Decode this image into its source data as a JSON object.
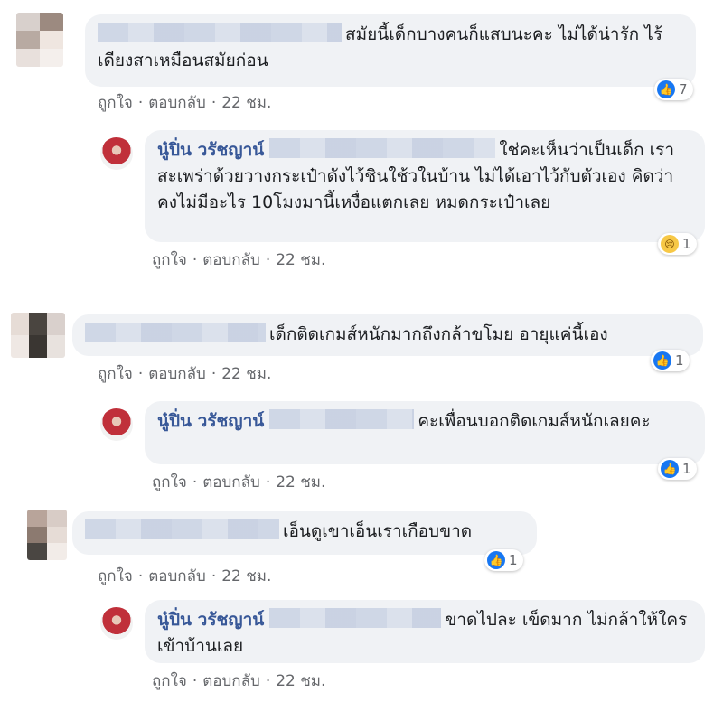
{
  "comments": [
    {
      "text": "สมัยนี้เด็กบางคนก็แสบนะคะ ไม่ได้น่ารัก ไร้เดียงสาเหมือนสมัยก่อน",
      "meta": {
        "like": "ถูกใจ",
        "reply": "ตอบกลับ",
        "time": "22 ชม."
      },
      "reaction": {
        "icon": "like-icon",
        "count": "7"
      }
    },
    {
      "author": "นู๋ปิ่น วรัชญาน์",
      "text": "ใช่คะเห็นว่าเป็นเด็ก เราสะเพร่าด้วยวางกระเป๋าดังไว้ชินใช้วในบ้าน ไม่ได้เอาไว้กับตัวเอง คิดว่าคงไม่มีอะไร 10โมงมานี้เหงื่อแตกเลย หมดกระเป๋าเลย",
      "meta": {
        "like": "ถูกใจ",
        "reply": "ตอบกลับ",
        "time": "22 ชม."
      },
      "reaction": {
        "icon": "sad-icon",
        "count": "1"
      }
    },
    {
      "text": "เด็กติดเกมส์หนักมากถึงกล้าขโมย อายุแค่นี้เอง",
      "meta": {
        "like": "ถูกใจ",
        "reply": "ตอบกลับ",
        "time": "22 ชม."
      },
      "reaction": {
        "icon": "like-icon",
        "count": "1"
      }
    },
    {
      "author": "นู๋ปิ่น วรัชญาน์",
      "text": "คะเพื่อนบอกติดเกมส์หนักเลยคะ",
      "meta": {
        "like": "ถูกใจ",
        "reply": "ตอบกลับ",
        "time": "22 ชม."
      },
      "reaction": {
        "icon": "like-icon",
        "count": "1"
      }
    },
    {
      "text": "เอ็นดูเขาเอ็นเราเกือบขาด",
      "meta": {
        "like": "ถูกใจ",
        "reply": "ตอบกลับ",
        "time": "22 ชม."
      },
      "reaction": {
        "icon": "like-icon",
        "count": "1"
      }
    },
    {
      "author": "นู๋ปิ่น วรัชญาน์",
      "text": "ขาดไปละ เข็ดมาก ไม่กล้าให้ใครเข้าบ้านเลย",
      "meta": {
        "like": "ถูกใจ",
        "reply": "ตอบกลับ",
        "time": "22 ชม."
      },
      "reaction": {
        "icon": "like-icon",
        "count": "1"
      }
    }
  ]
}
